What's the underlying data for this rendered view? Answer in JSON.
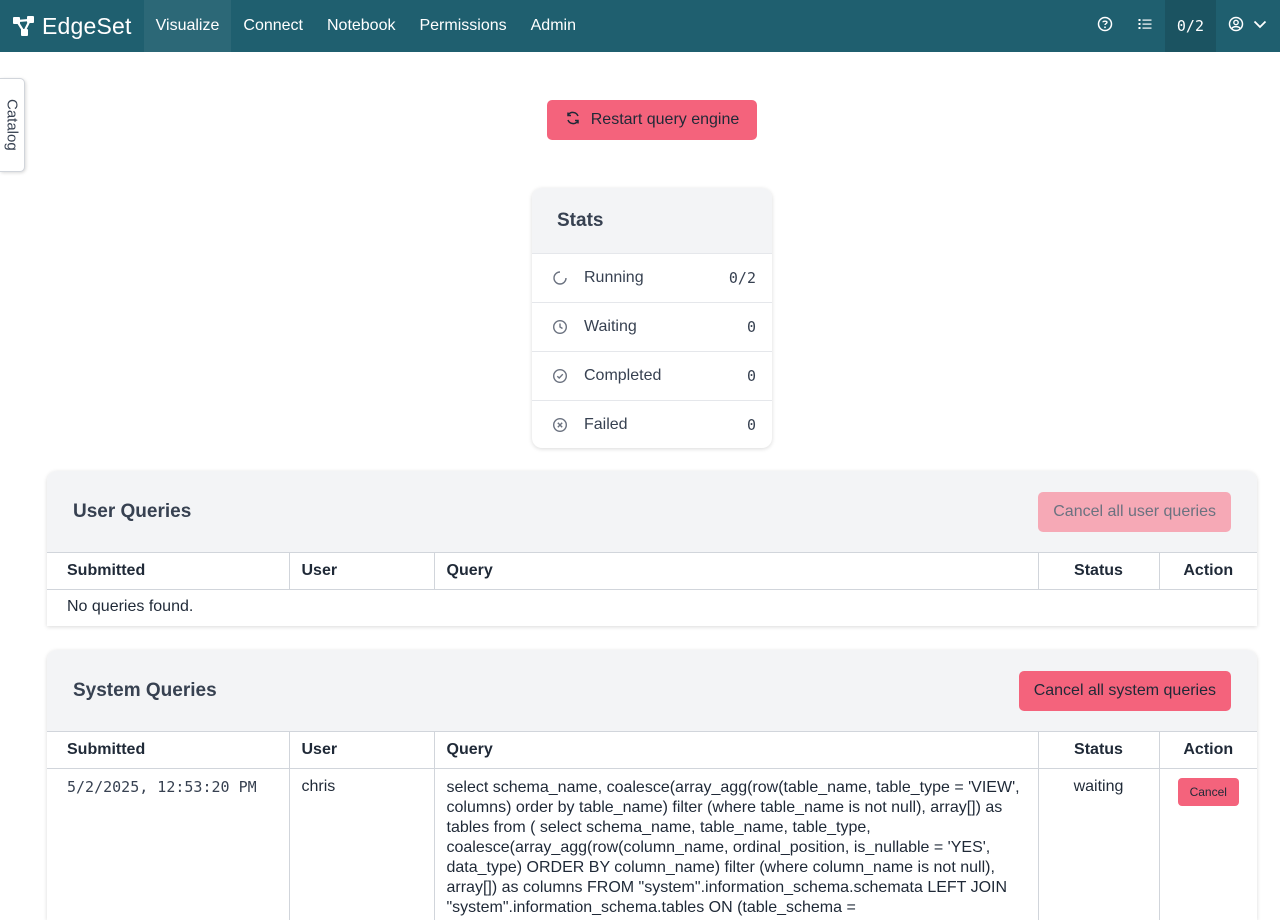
{
  "app": {
    "name": "EdgeSet"
  },
  "nav": {
    "items": [
      {
        "label": "Visualize"
      },
      {
        "label": "Connect"
      },
      {
        "label": "Notebook"
      },
      {
        "label": "Permissions"
      },
      {
        "label": "Admin"
      }
    ],
    "counter": "0/2",
    "icons": [
      "help-icon",
      "list-icon",
      "user-circle-icon",
      "chevron-down-icon"
    ]
  },
  "catalog_tab": {
    "label": "Catalog"
  },
  "restart_button": {
    "label": "Restart query engine",
    "icon": "refresh-icon"
  },
  "stats": {
    "title": "Stats",
    "rows": [
      {
        "label": "Running",
        "value": "0/2",
        "icon": "spinner-icon"
      },
      {
        "label": "Waiting",
        "value": "0",
        "icon": "clock-icon"
      },
      {
        "label": "Completed",
        "value": "0",
        "icon": "check-circle-icon"
      },
      {
        "label": "Failed",
        "value": "0",
        "icon": "x-circle-icon"
      }
    ]
  },
  "user_queries": {
    "title": "User Queries",
    "cancel_all_label": "Cancel all user queries",
    "columns": [
      "Submitted",
      "User",
      "Query",
      "Status",
      "Action"
    ],
    "empty_text": "No queries found."
  },
  "system_queries": {
    "title": "System Queries",
    "cancel_all_label": "Cancel all system queries",
    "columns": [
      "Submitted",
      "User",
      "Query",
      "Status",
      "Action"
    ],
    "rows": [
      {
        "submitted": "5/2/2025, 12:53:20 PM",
        "user": "chris",
        "query": "select schema_name, coalesce(array_agg(row(table_name, table_type = 'VIEW', columns) order by table_name) filter (where table_name is not null), array[]) as tables from ( select schema_name, table_name, table_type, coalesce(array_agg(row(column_name, ordinal_position, is_nullable = 'YES', data_type) ORDER BY column_name) filter (where column_name is not null), array[]) as columns FROM \"system\".information_schema.schemata LEFT JOIN \"system\".information_schema.tables ON (table_schema =",
        "status": "waiting",
        "action_label": "Cancel"
      }
    ]
  },
  "colors": {
    "topbar": "#1f5f6f",
    "accent": "#f4637c",
    "accent_disabled": "#f6a9b6",
    "panel_header": "#f3f4f6"
  }
}
